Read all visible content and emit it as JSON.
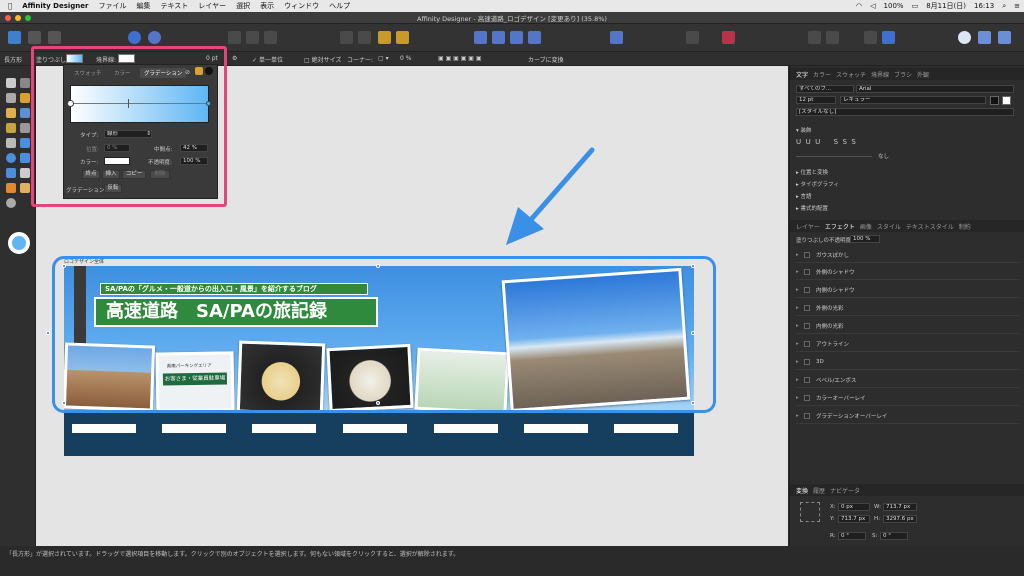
{
  "menubar": {
    "apple": "",
    "app_name": "Affinity Designer",
    "items": [
      "ファイル",
      "編集",
      "テキスト",
      "レイヤー",
      "選択",
      "表示",
      "ウィンドウ",
      "ヘルプ"
    ],
    "battery": "100%",
    "date": "8月11日(日)",
    "time": "16:13"
  },
  "window": {
    "title": "Affinity Designer - 高速道路_ロゴデザイン [変更あり] (35.8%)"
  },
  "context_bar": {
    "tool_name": "長方形",
    "fill_label": "塗りつぶし:",
    "stroke_label": "境界線:",
    "stroke_width": "0 pt",
    "single_unit": "単一単位",
    "absolute_size": "絶対サイズ",
    "corner_label": "コーナー:",
    "corner_value": "0 %",
    "convert_to_curves": "カーブに変換"
  },
  "gradient_popup": {
    "tabs": [
      "スウォッチ",
      "カラー",
      "グラデーション"
    ],
    "active_tab": "グラデーション",
    "type_label": "タイプ:",
    "type_value": "線形",
    "position_label": "位置:",
    "position_value": "0 %",
    "midpoint_label": "中間点:",
    "midpoint_value": "42 %",
    "color_label": "カラー:",
    "opacity_label": "不透明度:",
    "opacity_value": "100 %",
    "btn_end": "終点",
    "btn_insert": "挿入",
    "btn_copy": "コピー",
    "btn_delete": "削除",
    "gradient_label": "グラデーション:",
    "btn_reverse": "反転",
    "gradient_start": "#ffffff",
    "gradient_end": "#5fb6f3"
  },
  "canvas": {
    "layer_label": "ロゴデザイン全体",
    "subtitle": "SA/PAの「グルメ・一般道からの出入口・風景」を紹介するブログ",
    "title": "高速道路　SA/PAの旅記録",
    "sign_top": "県南パーキングエリア",
    "sign_main": "お客さま・従業員駐車場",
    "accent_selection": "#3a8fe6",
    "road_color": "#163f5f"
  },
  "right_panel": {
    "top_tabs": [
      "文字",
      "カラー",
      "スウォッチ",
      "境界線",
      "ブラシ",
      "外観"
    ],
    "active_top_tab": "文字",
    "all_fonts": "すべてのフ...",
    "font": "Arial",
    "size": "12 pt",
    "style": "レギュラー",
    "style_none": "[スタイルなし]",
    "decoration": "装飾",
    "none_label": "なし",
    "sections": [
      "位置と変換",
      "タイポグラフィ",
      "言語",
      "書式的配置"
    ],
    "mid_tabs": [
      "レイヤー",
      "エフェクト",
      "画像",
      "スタイル",
      "テキストスタイル",
      "制約"
    ],
    "active_mid_tab": "エフェクト",
    "fill_opacity_label": "塗りつぶしの不透明度:",
    "fill_opacity": "100 %",
    "effects": [
      "ガウスぼかし",
      "外側のシャドウ",
      "内側のシャドウ",
      "外側の光彩",
      "内側の光彩",
      "アウトライン",
      "3D",
      "ベベル/エンボス",
      "カラーオーバーレイ",
      "グラデーションオーバーレイ"
    ],
    "bottom_tabs": [
      "変換",
      "履歴",
      "ナビゲータ"
    ],
    "active_bottom_tab": "変換",
    "x_label": "X:",
    "x_value": "0 px",
    "y_label": "Y:",
    "y_value": "713.7 px",
    "w_label": "W:",
    "w_value": "713.7 px",
    "h_label": "H:",
    "h_value": "3297.6 px",
    "r_label": "R:",
    "r_value": "0 °",
    "s_label": "S:",
    "s_value": "0 °"
  },
  "status": {
    "text": "「長方形」が選択されています。ドラッグで選択項目を移動します。クリックで別のオブジェクトを選択します。何もない領域をクリックすると、選択が解除されます。"
  }
}
